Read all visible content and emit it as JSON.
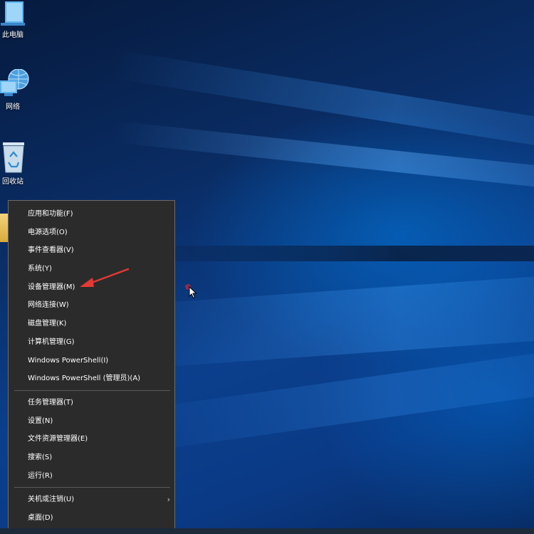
{
  "desktop": {
    "icons": [
      {
        "label": "此电脑",
        "icon": "computer-icon"
      },
      {
        "label": "网络",
        "icon": "network-icon"
      },
      {
        "label": "回收站",
        "icon": "recycle-bin-icon"
      }
    ]
  },
  "context_menu": {
    "group1": [
      {
        "label": "应用和功能(F)"
      },
      {
        "label": "电源选项(O)"
      },
      {
        "label": "事件查看器(V)"
      },
      {
        "label": "系统(Y)"
      },
      {
        "label": "设备管理器(M)"
      },
      {
        "label": "网络连接(W)"
      },
      {
        "label": "磁盘管理(K)"
      },
      {
        "label": "计算机管理(G)"
      },
      {
        "label": "Windows PowerShell(I)"
      },
      {
        "label": "Windows PowerShell (管理员)(A)"
      }
    ],
    "group2": [
      {
        "label": "任务管理器(T)"
      },
      {
        "label": "设置(N)"
      },
      {
        "label": "文件资源管理器(E)"
      },
      {
        "label": "搜索(S)"
      },
      {
        "label": "运行(R)"
      }
    ],
    "group3": [
      {
        "label": "关机或注销(U)",
        "submenu_icon": "chevron-right-icon"
      },
      {
        "label": "桌面(D)"
      }
    ],
    "arrow_glyph": "›"
  },
  "colors": {
    "menu_background": "#2b2b2b",
    "menu_border": "#6b6b6b",
    "menu_text": "#ffffff",
    "annotation_arrow": "#e53935"
  }
}
